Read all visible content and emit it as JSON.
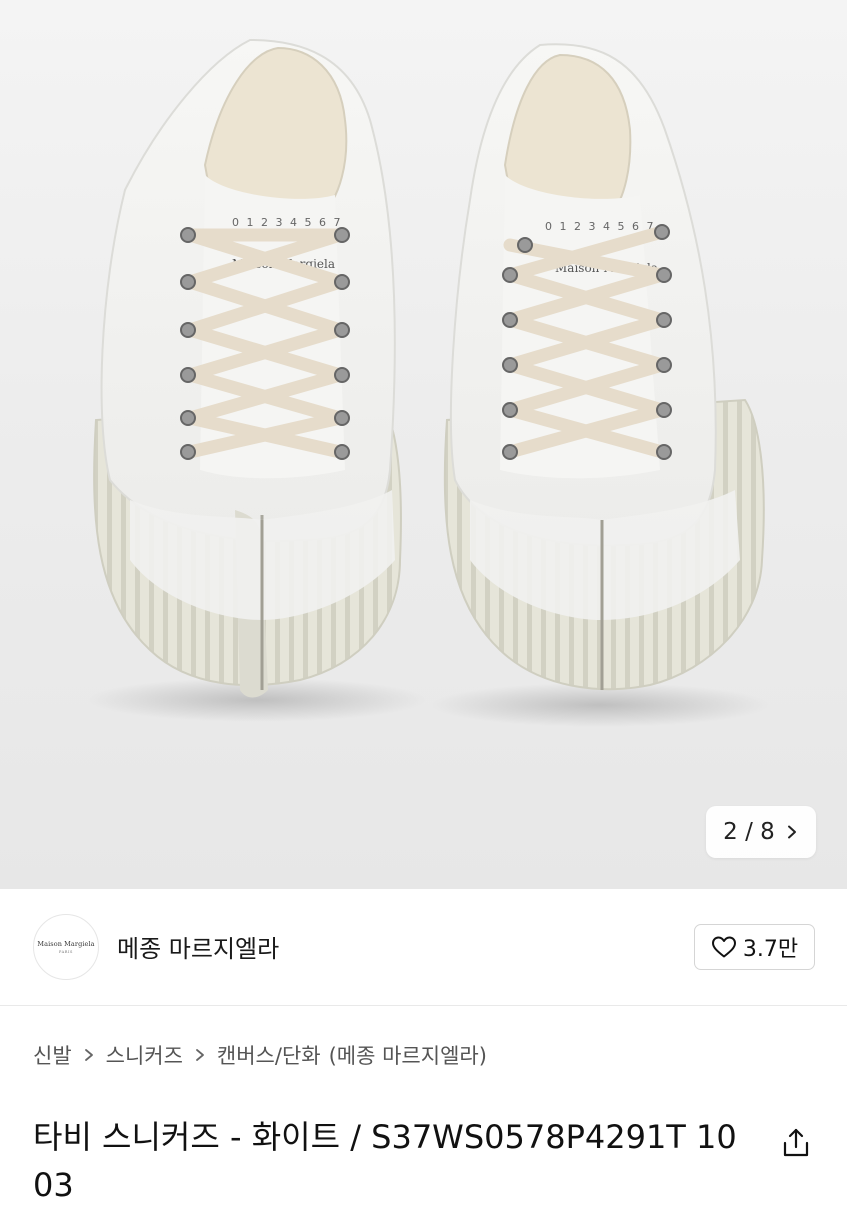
{
  "gallery": {
    "counter": "2 / 8",
    "logo_text": "Maison Margiela",
    "label_numbers": "0 1 2 3 4 5 6 7"
  },
  "brand": {
    "name": "메종 마르지엘라",
    "logo_text": "Maison Margiela",
    "logo_sub": "PARIS"
  },
  "like": {
    "count": "3.7만"
  },
  "breadcrumb": {
    "items": [
      "신발",
      "스니커즈",
      "캔버스/단화"
    ],
    "brand": "(메종 마르지엘라)"
  },
  "product": {
    "title": "타비 스니커즈 - 화이트 / S37WS0578P4291T 1003"
  },
  "icons": {
    "counter": "chevron-right-icon",
    "like": "heart-icon",
    "breadcrumb_separator": "chevron-right-icon",
    "share": "share-icon"
  }
}
